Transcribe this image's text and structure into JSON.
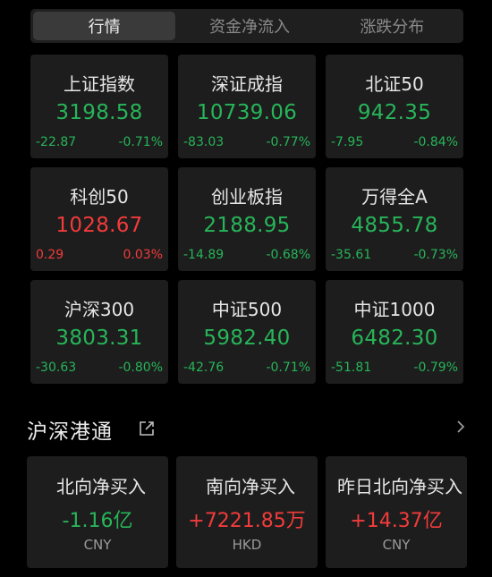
{
  "tabs": [
    {
      "label": "行情",
      "active": true
    },
    {
      "label": "资金净流入",
      "active": false
    },
    {
      "label": "涨跌分布",
      "active": false
    }
  ],
  "indices": [
    {
      "name": "上证指数",
      "price": "3198.58",
      "change": "-22.87",
      "pct": "-0.71%",
      "dir": "down"
    },
    {
      "name": "深证成指",
      "price": "10739.06",
      "change": "-83.03",
      "pct": "-0.77%",
      "dir": "down"
    },
    {
      "name": "北证50",
      "price": "942.35",
      "change": "-7.95",
      "pct": "-0.84%",
      "dir": "down"
    },
    {
      "name": "科创50",
      "price": "1028.67",
      "change": "0.29",
      "pct": "0.03%",
      "dir": "up"
    },
    {
      "name": "创业板指",
      "price": "2188.95",
      "change": "-14.89",
      "pct": "-0.68%",
      "dir": "down"
    },
    {
      "name": "万得全A",
      "price": "4855.78",
      "change": "-35.61",
      "pct": "-0.73%",
      "dir": "down"
    },
    {
      "name": "沪深300",
      "price": "3803.31",
      "change": "-30.63",
      "pct": "-0.80%",
      "dir": "down"
    },
    {
      "name": "中证500",
      "price": "5982.40",
      "change": "-42.76",
      "pct": "-0.71%",
      "dir": "down"
    },
    {
      "name": "中证1000",
      "price": "6482.30",
      "change": "-51.81",
      "pct": "-0.79%",
      "dir": "down"
    }
  ],
  "section": {
    "title": "沪深港通"
  },
  "flows": [
    {
      "name": "北向净买入",
      "value": "-1.16亿",
      "unit": "CNY",
      "dir": "down"
    },
    {
      "name": "南向净买入",
      "value": "+7221.85万",
      "unit": "HKD",
      "dir": "up"
    },
    {
      "name": "昨日北向净买入",
      "value": "+14.37亿",
      "unit": "CNY",
      "dir": "up"
    }
  ],
  "colors": {
    "up": "#f23b3b",
    "down": "#27b559",
    "background": "#000000",
    "card": "#1d1d1d"
  },
  "icons": {
    "section_link": "external-link-icon",
    "section_more": "chevron-right-icon"
  }
}
